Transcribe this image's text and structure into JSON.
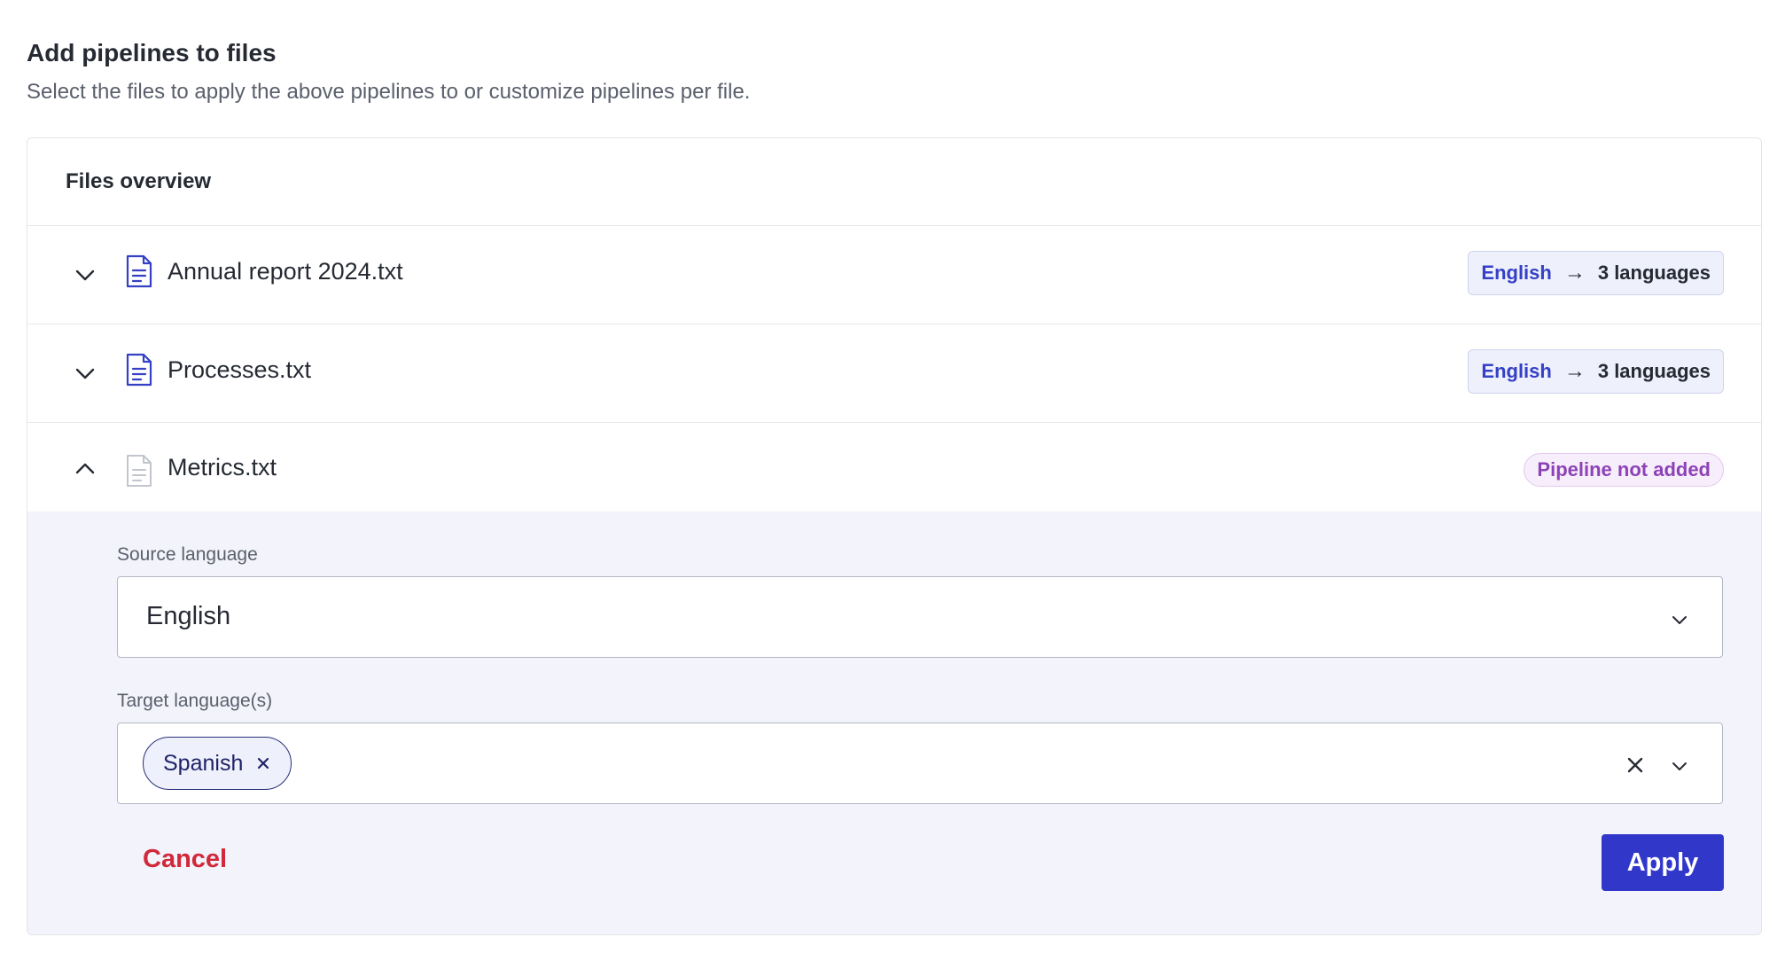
{
  "page": {
    "title": "Add pipelines to files",
    "subtitle": "Select the files to apply the above pipelines to or customize pipelines per file."
  },
  "overview": {
    "header": "Files overview",
    "files": [
      {
        "name": "Annual report 2024.txt",
        "expanded": false,
        "pipeline": {
          "source": "English",
          "arrow": "→",
          "target": "3 languages"
        }
      },
      {
        "name": "Processes.txt",
        "expanded": false,
        "pipeline": {
          "source": "English",
          "arrow": "→",
          "target": "3 languages"
        }
      },
      {
        "name": "Metrics.txt",
        "expanded": true,
        "status": "Pipeline not added",
        "form": {
          "source_label": "Source language",
          "source_value": "English",
          "target_label": "Target language(s)",
          "target_chips": [
            "Spanish"
          ],
          "cancel_label": "Cancel",
          "apply_label": "Apply"
        }
      }
    ]
  },
  "icons": {
    "chevron_down": "chevron-down-icon",
    "chevron_up": "chevron-up-icon",
    "file": "file-text-icon",
    "close": "close-icon"
  },
  "colors": {
    "accent": "#3138c9",
    "accent_text": "#3540c4",
    "danger": "#d1283a",
    "status_purple": "#8d42b7",
    "expanded_bg": "#f2f3fb"
  }
}
